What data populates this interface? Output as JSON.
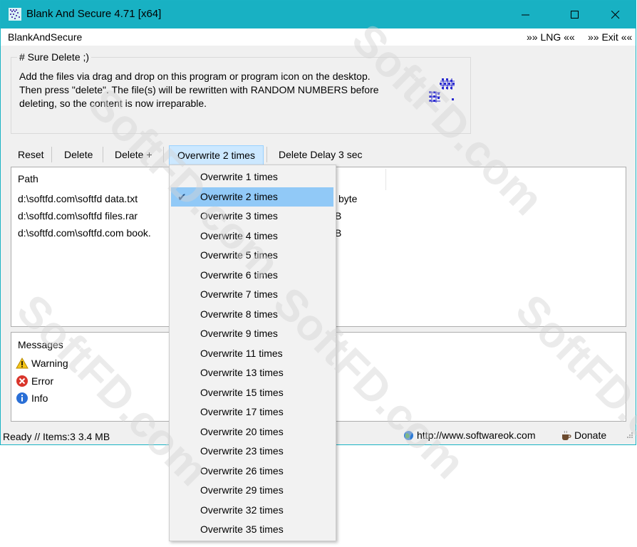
{
  "window": {
    "title": "Blank And Secure 4.71 [x64]",
    "accent_color": "#18b1c3"
  },
  "menubar": {
    "app_label": "BlankAndSecure",
    "lng_label": "»» LNG ««",
    "exit_label": "»» Exit ««"
  },
  "intro": {
    "group_title": "# Sure Delete ;)",
    "lines": [
      "Add the files via drag and drop on this program or program icon on the desktop.",
      "Then press \"delete\". The file(s) will be rewritten with RANDOM NUMBERS before",
      "deleting, so the content is now irreparable."
    ]
  },
  "toolbar": {
    "reset": "Reset",
    "delete": "Delete",
    "delete_plus": "Delete +",
    "overwrite": "Overwrite 2 times",
    "delete_delay": "Delete Delay 3 sec"
  },
  "file_list": {
    "column_path": "Path",
    "rows": [
      {
        "path": "d:\\softfd.com\\softfd data.txt",
        "size": "byte"
      },
      {
        "path": "d:\\softfd.com\\softfd files.rar",
        "size": "B"
      },
      {
        "path": "d:\\softfd.com\\softfd.com book.",
        "size": "B"
      }
    ]
  },
  "messages": {
    "title": "Messages",
    "items": [
      {
        "icon": "warning-icon",
        "label": "Warning"
      },
      {
        "icon": "error-icon",
        "label": "Error"
      },
      {
        "icon": "info-icon",
        "label": "Info"
      }
    ]
  },
  "statusbar": {
    "status": "Ready // Items:3 3.4 MB",
    "url": "http://www.softwareok.com",
    "donate": "Donate"
  },
  "overwrite_menu": {
    "selected": "Overwrite 2 times",
    "items": [
      "Overwrite 1 times",
      "Overwrite 2 times",
      "Overwrite 3 times",
      "Overwrite 4 times",
      "Overwrite 5 times",
      "Overwrite 6 times",
      "Overwrite 7 times",
      "Overwrite 8 times",
      "Overwrite 9 times",
      "Overwrite 11 times",
      "Overwrite 13 times",
      "Overwrite 15 times",
      "Overwrite 17 times",
      "Overwrite 20 times",
      "Overwrite 23 times",
      "Overwrite 26 times",
      "Overwrite 29 times",
      "Overwrite 32 times",
      "Overwrite 35 times"
    ]
  },
  "watermark": {
    "text": "SoftFD.com"
  }
}
